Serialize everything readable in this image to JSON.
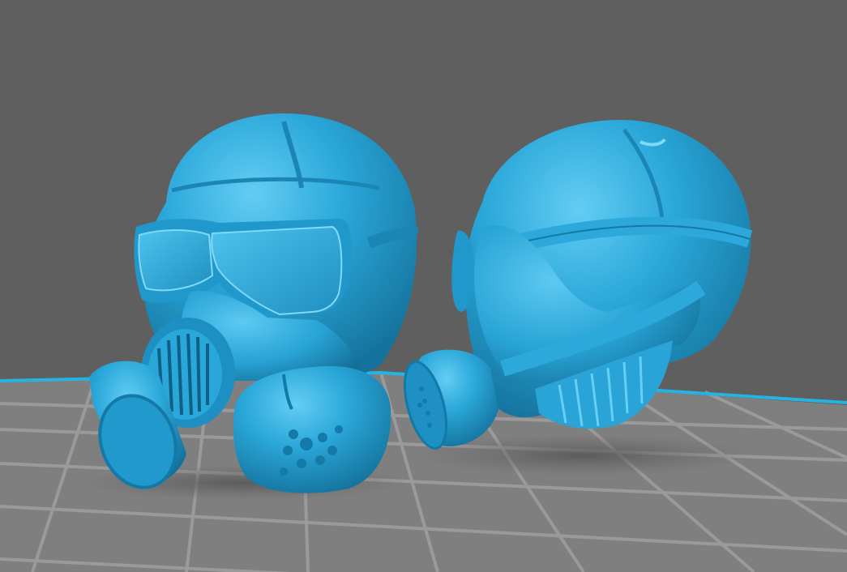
{
  "viewport": {
    "label": "",
    "background_color": "#5f5f5f",
    "plate_color": "#848484",
    "grid_line_color": "#9a9a9a",
    "plate_edge_color": "#27b2e2",
    "model_color": "#2aa7d9",
    "model_highlight_color": "#55c6f0",
    "model_shadow_color": "#146f98"
  },
  "objects": [
    {
      "name": "gas-mask-helmet-front-facing",
      "view": "front-three-quarter"
    },
    {
      "name": "gas-mask-helmet-side-facing",
      "view": "left-profile"
    }
  ]
}
